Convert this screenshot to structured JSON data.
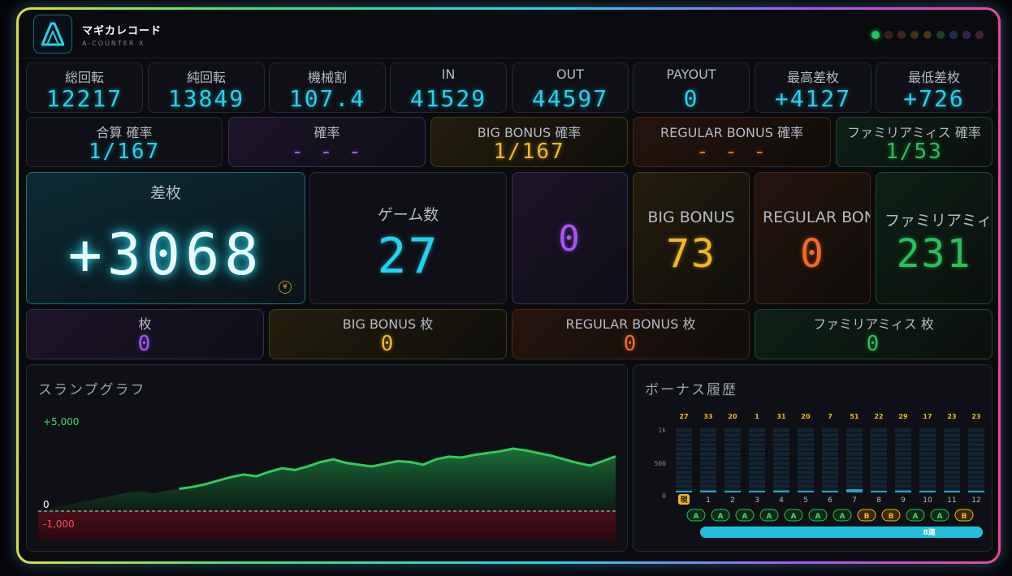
{
  "header": {
    "title": "マギカレコード",
    "subtitle": "A-COUNTER X"
  },
  "status_dots": [
    "#22c55e",
    "#3a1b1b",
    "#4a1d1d",
    "#4a2e12",
    "#4a3a12",
    "#16402a",
    "#1c2b52",
    "#3a1f52",
    "#4a1a35"
  ],
  "stats": [
    {
      "label": "総回転",
      "value": "12217"
    },
    {
      "label": "純回転",
      "value": "13849"
    },
    {
      "label": "機械割",
      "value": "107.4"
    },
    {
      "label": "IN",
      "value": "41529"
    },
    {
      "label": "OUT",
      "value": "44597"
    },
    {
      "label": "PAYOUT",
      "value": "0"
    },
    {
      "label": "最高差枚",
      "value": "+4127"
    },
    {
      "label": "最低差枚",
      "value": "+726"
    }
  ],
  "probabilities": [
    {
      "label": "合算 確率",
      "value": "1/167"
    },
    {
      "label": "確率",
      "value": "- - -"
    },
    {
      "label": "BIG BONUS 確率",
      "value": "1/167"
    },
    {
      "label": "REGULAR BONUS 確率",
      "value": "- - -"
    },
    {
      "label": "ファミリアミィス 確率",
      "value": "1/53"
    }
  ],
  "big_cards": {
    "diff": {
      "label": "差枚",
      "value": "+3068",
      "coin": "¥"
    },
    "games": {
      "label": "ゲーム数",
      "value": "27"
    },
    "blank": {
      "value": "0"
    },
    "big": {
      "label": "BIG BONUS",
      "value": "73"
    },
    "regular": {
      "label": "REGULAR BONUS",
      "value": "0"
    },
    "familiar": {
      "label": "ファミリアミィス",
      "value": "231"
    }
  },
  "medals": [
    {
      "label": "枚",
      "value": "0"
    },
    {
      "label": "BIG BONUS 枚",
      "value": "0"
    },
    {
      "label": "REGULAR BONUS 枚",
      "value": "0"
    },
    {
      "label": "ファミリアミィス 枚",
      "value": "0"
    }
  ],
  "slump": {
    "title": "スランプグラフ",
    "top_label": "+5,000",
    "zero_label": "0",
    "bottom_label": "-1,000"
  },
  "chart_data": {
    "type": "area",
    "title": "スランプグラフ",
    "ylim": [
      -1000,
      5000
    ],
    "y_labels": [
      "+5,000",
      "0",
      "-1,000"
    ],
    "values": [
      0,
      150,
      300,
      450,
      600,
      750,
      900,
      1050,
      1100,
      1000,
      1150,
      1250,
      1350,
      1500,
      1700,
      1900,
      2050,
      1950,
      2200,
      2400,
      2300,
      2500,
      2750,
      2900,
      2700,
      2600,
      2500,
      2650,
      2800,
      2750,
      2600,
      2900,
      3050,
      3000,
      3150,
      3250,
      3350,
      3500,
      3400,
      3250,
      3100,
      2900,
      2700,
      2550,
      2800,
      3068
    ]
  },
  "bonus_history": {
    "title": "ボーナス履歴",
    "y_labels": [
      "1k",
      "500",
      "0"
    ],
    "games": [
      "27",
      "33",
      "20",
      "1",
      "31",
      "20",
      "7",
      "51",
      "22",
      "29",
      "17",
      "23",
      "23"
    ],
    "indices": [
      "現",
      "1",
      "2",
      "3",
      "4",
      "5",
      "6",
      "7",
      "8",
      "9",
      "10",
      "11",
      "12"
    ],
    "types": [
      "A",
      "A",
      "A",
      "A",
      "A",
      "A",
      "A",
      "B",
      "B",
      "A",
      "A",
      "B"
    ],
    "fill": [
      0.02,
      0.03,
      0.02,
      0.01,
      0.03,
      0.02,
      0.01,
      0.05,
      0.02,
      0.03,
      0.02,
      0.02,
      0.02
    ],
    "streak_label": "8連",
    "streak_fill": 1.0
  }
}
